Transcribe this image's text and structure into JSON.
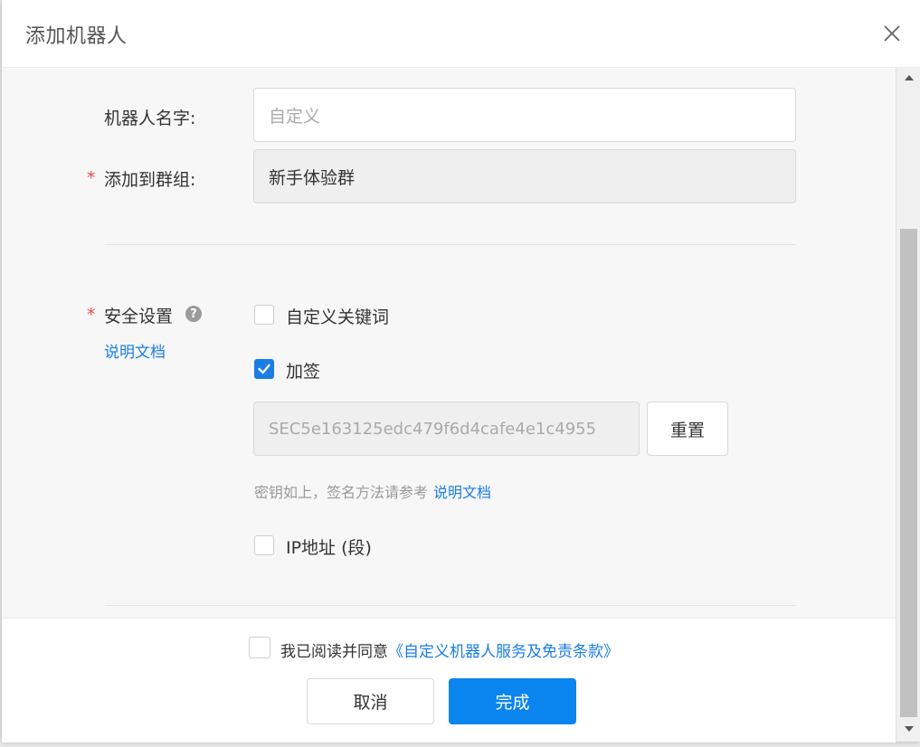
{
  "dialog": {
    "title": "添加机器人"
  },
  "form": {
    "name_label": "机器人名字:",
    "name_placeholder": "自定义",
    "group_label": "添加到群组:",
    "group_value": "新手体验群",
    "required_mark": "*",
    "security_label": "安全设置",
    "help_glyph": "?",
    "doc_link": "说明文档",
    "options": [
      {
        "label": "自定义关键词",
        "checked": false
      },
      {
        "label": "加签",
        "checked": true
      },
      {
        "label": "IP地址 (段)",
        "checked": false
      }
    ],
    "secret_value": "SEC5e163125edc479f6d4cafe4e1c4955",
    "reset_label": "重置",
    "hint_text": "密钥如上，签名方法请参考",
    "hint_link": "说明文档"
  },
  "footer": {
    "agree_text": "我已阅读并同意",
    "terms_link": "《自定义机器人服务及免责条款》",
    "cancel_label": "取消",
    "done_label": "完成"
  },
  "colors": {
    "accent": "#1a7de6",
    "primary_button": "#0a84ee",
    "required": "#e64b4b"
  }
}
